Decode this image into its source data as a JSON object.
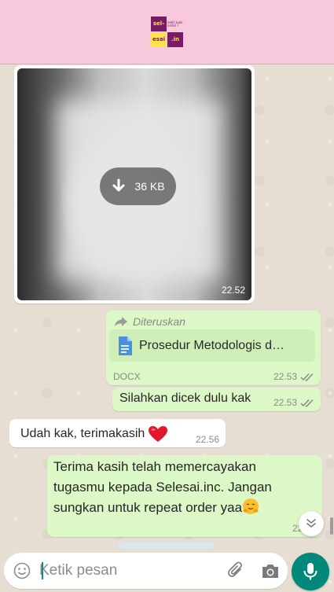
{
  "header": {
    "logo": {
      "top_left": "sel-",
      "top_right": "lebih baik ambil ?",
      "bottom_left": "esai",
      "bottom_right": ".in"
    }
  },
  "image_message": {
    "download_size": "36 KB",
    "time": "22.52"
  },
  "forwarded_message": {
    "label": "Diteruskan",
    "doc_name": "Prosedur Metodologis d…",
    "doc_type": "DOCX",
    "time": "22.53"
  },
  "messages": [
    {
      "direction": "out",
      "text": "Silahkan dicek dulu kak",
      "time": "22.53"
    },
    {
      "direction": "in",
      "text": "Udah kak, terimakasih",
      "time": "22.56"
    },
    {
      "direction": "out",
      "text": "Terima kasih telah memercayakan tugasmu kepada Selesai.inc. Jangan sungkan untuk repeat order yaa",
      "time": "22.57"
    }
  ],
  "composer": {
    "placeholder": "Ketik pesan"
  },
  "colors": {
    "header_bg": "#f8c8dc",
    "outgoing_bubble": "#dcf8c6",
    "incoming_bubble": "#ffffff",
    "mic_button": "#00897b",
    "read_ticks": "#8a8a8a"
  },
  "icons": [
    "download-icon",
    "forward-icon",
    "document-icon",
    "double-check-icon",
    "heart-emoji",
    "hugging-emoji",
    "chevron-down-icon",
    "emoji-icon",
    "attach-icon",
    "camera-icon",
    "mic-icon"
  ]
}
